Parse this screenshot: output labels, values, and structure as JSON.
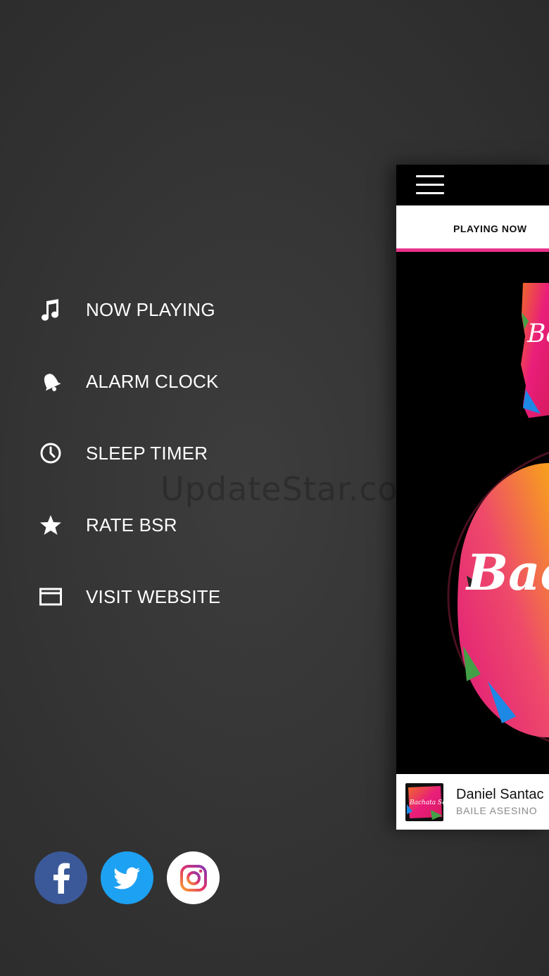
{
  "menu": {
    "items": [
      {
        "label": "NOW PLAYING",
        "icon": "music-note-icon"
      },
      {
        "label": "ALARM CLOCK",
        "icon": "bell-icon"
      },
      {
        "label": "SLEEP TIMER",
        "icon": "clock-icon"
      },
      {
        "label": "RATE BSR",
        "icon": "star-icon"
      },
      {
        "label": "VISIT WEBSITE",
        "icon": "browser-window-icon"
      }
    ]
  },
  "watermark": "UpdateStar.com",
  "social": {
    "facebook": {
      "icon": "facebook-icon",
      "color": "#3b5998"
    },
    "twitter": {
      "icon": "twitter-icon",
      "color": "#1da1f2"
    },
    "instagram": {
      "icon": "instagram-icon",
      "color": "#ffffff"
    }
  },
  "panel": {
    "tab_label": "PLAYING NOW",
    "accent_color": "#e8328a",
    "artwork_text_top": "Ba",
    "artwork_text_main": "Bac",
    "now_playing": {
      "artist": "Daniel Santac",
      "song": "BAILE ASESINO",
      "thumb_text": "Bachata Sensual"
    }
  }
}
